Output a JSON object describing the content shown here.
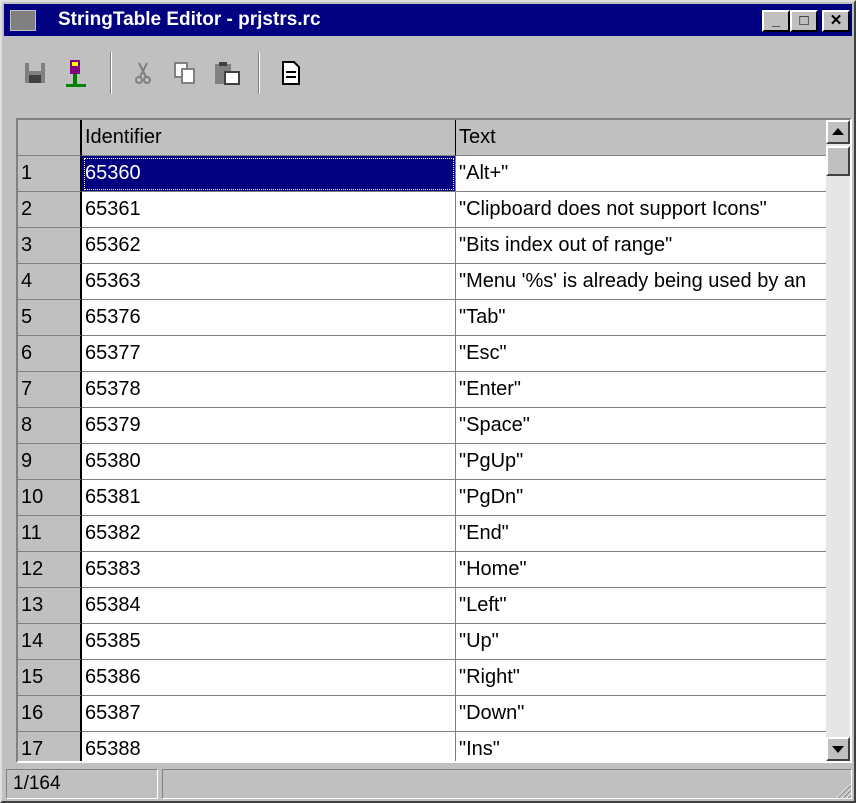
{
  "window": {
    "title": "StringTable Editor - prjstrs.rc",
    "controls": {
      "minimize": "_",
      "maximize": "□",
      "close": "✕"
    }
  },
  "toolbar": {
    "buttons": [
      "save-icon",
      "import-icon",
      "cut-icon",
      "copy-icon",
      "paste-icon",
      "properties-icon"
    ]
  },
  "grid": {
    "columns": [
      "Identifier",
      "Text"
    ],
    "rows": [
      {
        "n": "1",
        "id": "65360",
        "text": "\"Alt+\""
      },
      {
        "n": "2",
        "id": "65361",
        "text": "\"Clipboard does not support Icons\""
      },
      {
        "n": "3",
        "id": "65362",
        "text": "\"Bits index out of range\""
      },
      {
        "n": "4",
        "id": "65363",
        "text": "\"Menu '%s' is already being used by an"
      },
      {
        "n": "5",
        "id": "65376",
        "text": "\"Tab\""
      },
      {
        "n": "6",
        "id": "65377",
        "text": "\"Esc\""
      },
      {
        "n": "7",
        "id": "65378",
        "text": "\"Enter\""
      },
      {
        "n": "8",
        "id": "65379",
        "text": "\"Space\""
      },
      {
        "n": "9",
        "id": "65380",
        "text": "\"PgUp\""
      },
      {
        "n": "10",
        "id": "65381",
        "text": "\"PgDn\""
      },
      {
        "n": "11",
        "id": "65382",
        "text": "\"End\""
      },
      {
        "n": "12",
        "id": "65383",
        "text": "\"Home\""
      },
      {
        "n": "13",
        "id": "65384",
        "text": "\"Left\""
      },
      {
        "n": "14",
        "id": "65385",
        "text": "\"Up\""
      },
      {
        "n": "15",
        "id": "65386",
        "text": "\"Right\""
      },
      {
        "n": "16",
        "id": "65387",
        "text": "\"Down\""
      },
      {
        "n": "17",
        "id": "65388",
        "text": "\"Ins\""
      }
    ]
  },
  "status": {
    "position": "1/164",
    "message": ""
  },
  "colors": {
    "titlebar": "#000080",
    "face": "#c0c0c0",
    "selection": "#000080"
  }
}
